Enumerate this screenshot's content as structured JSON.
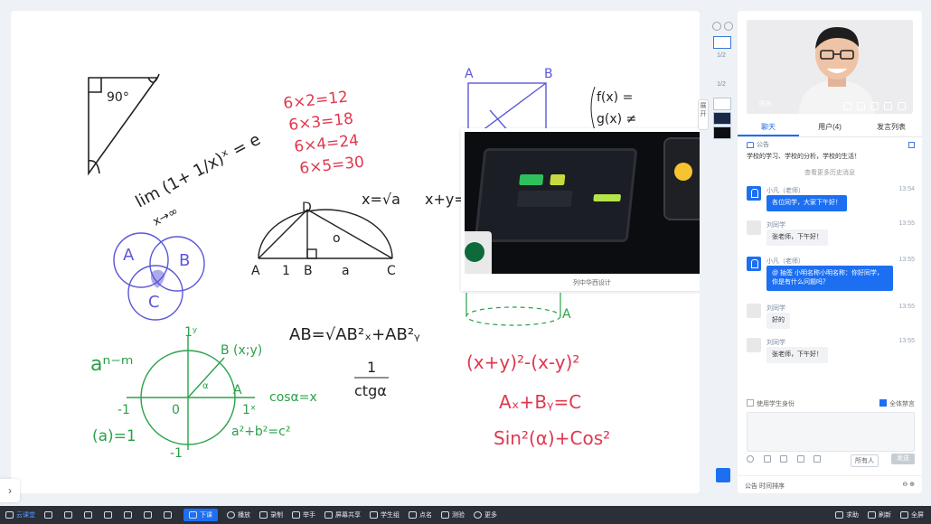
{
  "board": {
    "image_caption": "列中华西设计"
  },
  "page_strip": {
    "page1": "1/2",
    "page2": "1/2",
    "side_tab": "展开"
  },
  "video": {
    "name": "陈辰"
  },
  "tabs": [
    {
      "label": "聊天",
      "active": true
    },
    {
      "label": "用户(4)",
      "active": false
    },
    {
      "label": "发言列表",
      "active": false
    }
  ],
  "notice": {
    "title": "公告",
    "text": "学校的学习、学校的分析，学校的生活！"
  },
  "more_messages": "查看更多历史消息",
  "messages": [
    {
      "name": "小凡（老师）",
      "time": "13:54",
      "text": "各位同学，大家下午好！",
      "role": "teacher"
    },
    {
      "name": "刘同学",
      "time": "13:55",
      "text": "张老师，下午好！",
      "role": "student"
    },
    {
      "name": "小凡（老师）",
      "time": "13:55",
      "text": "@ 抽签 小明名称小明名称：你好同学，你是有什么问题吗？",
      "role": "teacher"
    },
    {
      "name": "刘同学",
      "time": "13:55",
      "text": "好的",
      "role": "student"
    },
    {
      "name": "刘同学",
      "time": "13:55",
      "text": "张老师，下午好！",
      "role": "student"
    }
  ],
  "options": {
    "left": "使用学生身份",
    "right": "全体禁言"
  },
  "composer": {
    "send_to": "所有人",
    "send": "发送"
  },
  "panel_footer": {
    "left": "公告  时间排序",
    "right": "⊖ ⊕"
  },
  "bottom_bar": {
    "logo": "云课堂",
    "items": [
      "下课",
      "播放",
      "录制",
      "举手",
      "屏幕共享",
      "学生组",
      "点名",
      "测验",
      "更多"
    ],
    "right": [
      "求助",
      "刷新",
      "全屏"
    ]
  }
}
